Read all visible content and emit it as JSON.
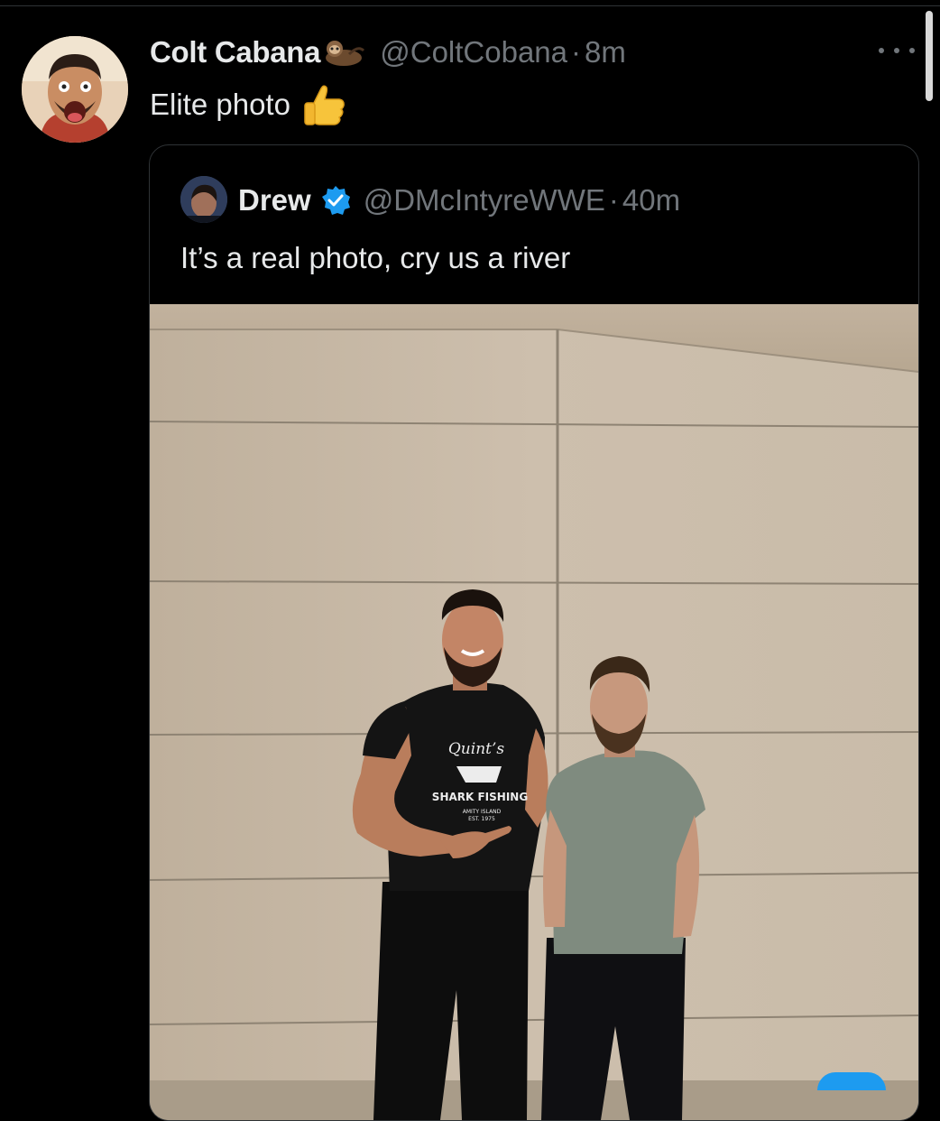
{
  "tweet": {
    "author_name": "Colt Cabana",
    "author_handle": "@ColtCobana",
    "separator": "·",
    "time": "8m",
    "text": "Elite photo",
    "name_emoji": "sloth-emoji",
    "text_emoji": "thumbs-up-emoji"
  },
  "quote": {
    "author_name": "Drew",
    "verified": true,
    "author_handle": "@DMcIntyreWWE",
    "separator": "·",
    "time": "40m",
    "text": "It’s a real photo, cry us a river",
    "shirt_print": {
      "line1": "Quint’s",
      "line2": "SHARK FISHING",
      "line3": "AMITY ISLAND",
      "line4": "EST. 1975"
    }
  },
  "colors": {
    "background": "#000000",
    "text_primary": "#e7e9ea",
    "text_secondary": "#71767b",
    "border": "#2f3336",
    "verified_blue": "#1d9bf0"
  }
}
